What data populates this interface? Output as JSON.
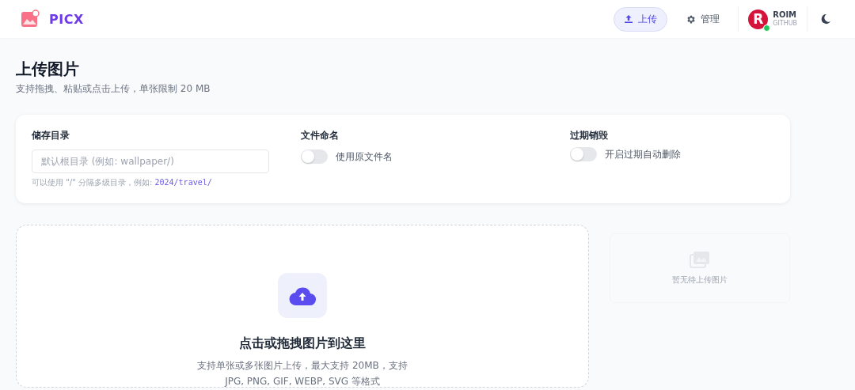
{
  "header": {
    "brand": "PICX",
    "nav": [
      {
        "label": "上传",
        "kind": "upload",
        "selected": true
      },
      {
        "label": "管理",
        "kind": "manage",
        "selected": false
      }
    ],
    "user": {
      "avatar_letter": "R",
      "name": "ROIM",
      "provider": "GITHUB",
      "online": true
    }
  },
  "page": {
    "title": "上传图片",
    "subtitle": "支持拖拽、粘贴或点击上传，单张限制 20 MB"
  },
  "settings": {
    "directory": {
      "label": "储存目录",
      "placeholder": "默认根目录 (例如: wallpaper/)",
      "hint": "可以使用 \"/\" 分隔多级目录，例如:",
      "hint_example": "2024/travel/"
    },
    "toggles": [
      {
        "label": "文件命名",
        "text": "使用原文件名",
        "on": false
      },
      {
        "label": "过期销毁",
        "text": "开启过期自动删除",
        "on": false
      }
    ]
  },
  "dropzone": {
    "title": "点击或拖拽图片到这里",
    "lines": [
      "支持单张或多张图片上传，最大支持 20MB，支持",
      "JPG, PNG, GIF, WEBP, SVG 等格式"
    ]
  },
  "queue": {
    "empty_text": "暂无待上传图片"
  }
}
